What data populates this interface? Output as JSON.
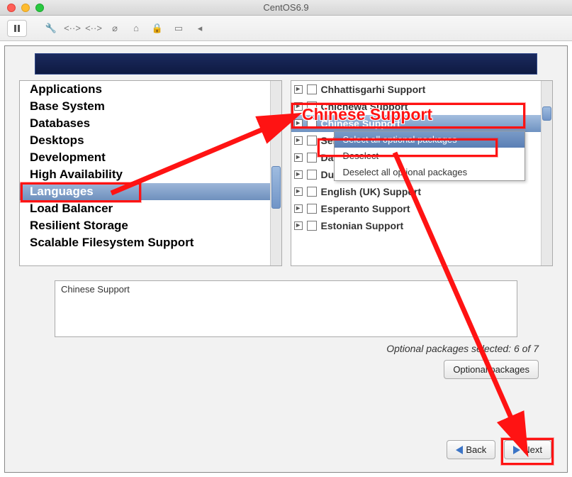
{
  "window": {
    "title": "CentOS6.9"
  },
  "sidebar": {
    "items": [
      "Applications",
      "Base System",
      "Databases",
      "Desktops",
      "Development",
      "High Availability",
      "Languages",
      "Load Balancer",
      "Resilient Storage",
      "Scalable Filesystem Support"
    ],
    "selected_index": 6
  },
  "packages": {
    "items": [
      "Chhattisgarhi Support",
      "Chichewa Support",
      "Chinese Support",
      "Select",
      "Danish Support",
      "Dutch Support",
      "English (UK) Support",
      "Esperanto Support",
      "Estonian Support"
    ],
    "selected_index": 2
  },
  "context_menu": {
    "items": [
      "Select all optional packages",
      "Deselect",
      "Deselect all optional packages"
    ],
    "highlighted_index": 0
  },
  "description": {
    "text": "Chinese Support"
  },
  "optional_status": {
    "text": "Optional packages selected: 6 of 7"
  },
  "buttons": {
    "optional_packages": "Optional packages",
    "back": "Back",
    "next": "Next"
  },
  "annotations": {
    "label1": "Chinese Support"
  }
}
